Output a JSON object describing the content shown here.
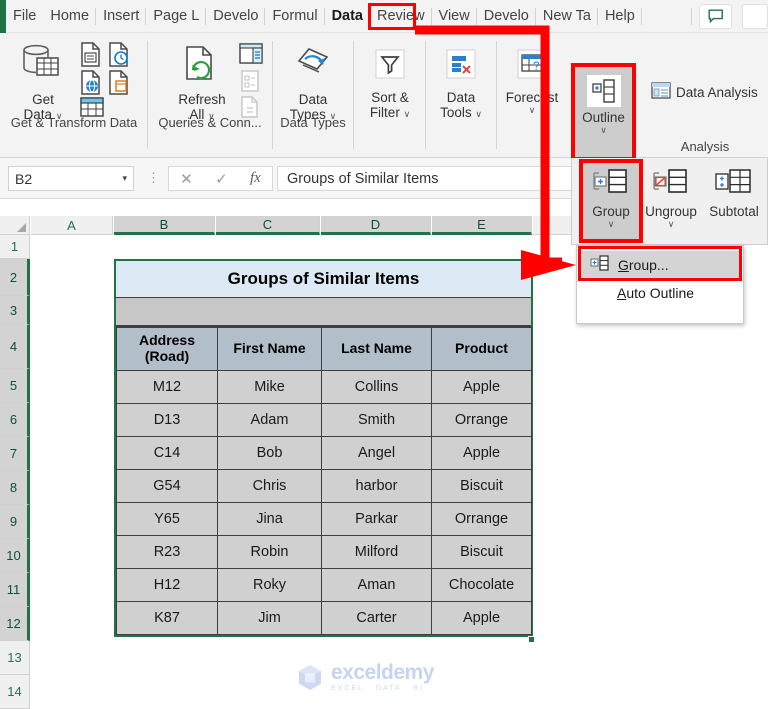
{
  "app": {
    "name": "Microsoft Excel",
    "accent_green": "#217346",
    "annotation_red": "#ff0000"
  },
  "tabs": [
    {
      "label": "File",
      "active": false
    },
    {
      "label": "Home",
      "active": false
    },
    {
      "label": "Insert",
      "active": false
    },
    {
      "label": "Page L",
      "active": false
    },
    {
      "label": "Develo",
      "active": false
    },
    {
      "label": "Formul",
      "active": false
    },
    {
      "label": "Data",
      "active": true
    },
    {
      "label": "Review",
      "active": false
    },
    {
      "label": "View",
      "active": false
    },
    {
      "label": "Develo",
      "active": false
    },
    {
      "label": "New Ta",
      "active": false
    },
    {
      "label": "Help",
      "active": false
    }
  ],
  "titlebar": {
    "comment_icon": "comment-icon"
  },
  "ribbon": {
    "groups": [
      {
        "label": "Get & Transform Data",
        "buttons": [
          {
            "label_line1": "Get",
            "label_line2": "Data",
            "caret": "∨",
            "icon": "get-data-icon"
          }
        ]
      },
      {
        "label": "Queries & Conn...",
        "buttons": [
          {
            "label_line1": "Refresh",
            "label_line2": "All",
            "caret": "∨",
            "icon": "refresh-all-icon"
          }
        ]
      },
      {
        "label": "Data Types",
        "buttons": [
          {
            "label_line1": "Data",
            "label_line2": "Types",
            "caret": "∨",
            "icon": "data-types-icon"
          }
        ]
      },
      {
        "label": "",
        "buttons": [
          {
            "label_line1": "Sort &",
            "label_line2": "Filter",
            "caret": "∨",
            "icon": "filter-funnel-icon"
          }
        ]
      },
      {
        "label": "",
        "buttons": [
          {
            "label_line1": "Data",
            "label_line2": "Tools",
            "caret": "∨",
            "icon": "data-tools-icon"
          }
        ]
      },
      {
        "label": "",
        "buttons": [
          {
            "label_line1": "Forecast",
            "label_line2": "",
            "caret": "∨",
            "icon": "forecast-icon"
          }
        ]
      },
      {
        "label": "",
        "buttons": [
          {
            "label_line1": "Outline",
            "label_line2": "",
            "caret": "∨",
            "icon": "outline-icon",
            "highlighted": true
          }
        ]
      },
      {
        "label": "Analysis",
        "buttons": [
          {
            "label_line1": "Data Analysis",
            "label_line2": "",
            "caret": "",
            "icon": "data-analysis-icon"
          }
        ]
      }
    ]
  },
  "outline_dropdown": {
    "buttons": [
      {
        "label": "Group",
        "caret": "∨",
        "icon": "group-icon",
        "highlighted": true
      },
      {
        "label": "Ungroup",
        "caret": "∨",
        "icon": "ungroup-icon",
        "highlighted": false
      },
      {
        "label": "Subtotal",
        "caret": "",
        "icon": "subtotal-icon",
        "highlighted": false
      }
    ],
    "menu_items": [
      {
        "label": "Group...",
        "accel": "G",
        "rest": "roup...",
        "icon": "group-icon",
        "highlighted": true
      },
      {
        "label": "Auto Outline",
        "accel": "A",
        "rest": "uto Outline",
        "icon": "",
        "highlighted": false
      }
    ]
  },
  "formula_bar": {
    "name_box_value": "B2",
    "name_box_caret": "▾",
    "cancel_icon": "✕",
    "confirm_icon": "✓",
    "fx_label": "fx",
    "formula_value": "Groups of Similar Items"
  },
  "grid": {
    "columns": [
      "A",
      "B",
      "C",
      "D",
      "E"
    ],
    "selected_columns": [
      "B",
      "C",
      "D",
      "E"
    ],
    "rows": [
      "1",
      "2",
      "3",
      "4",
      "5",
      "6",
      "7",
      "8",
      "9",
      "10",
      "11",
      "12",
      "13",
      "14"
    ],
    "selected_rows": [
      "2",
      "3",
      "4",
      "5",
      "6",
      "7",
      "8",
      "9",
      "10",
      "11",
      "12"
    ]
  },
  "table": {
    "title": "Groups of Similar Items",
    "headers": [
      "Address (Road)",
      "First Name",
      "Last Name",
      "Product"
    ],
    "header_line1": [
      "Address",
      "First Name",
      "Last Name",
      "Product"
    ],
    "header_line2": [
      "(Road)",
      "",
      "",
      ""
    ],
    "rows": [
      [
        "M12",
        "Mike",
        "Collins",
        "Apple"
      ],
      [
        "D13",
        "Adam",
        "Smith",
        "Orrange"
      ],
      [
        "C14",
        "Bob",
        "Angel",
        "Apple"
      ],
      [
        "G54",
        "Chris",
        "harbor",
        "Biscuit"
      ],
      [
        "Y65",
        "Jina",
        "Parkar",
        "Orrange"
      ],
      [
        "R23",
        "Robin",
        "Milford",
        "Biscuit"
      ],
      [
        "H12",
        "Roky",
        "Aman",
        "Chocolate"
      ],
      [
        "K87",
        "Jim",
        "Carter",
        "Apple"
      ]
    ]
  },
  "watermark": {
    "name": "exceldemy",
    "tagline": "EXCEL · DATA · BI"
  }
}
